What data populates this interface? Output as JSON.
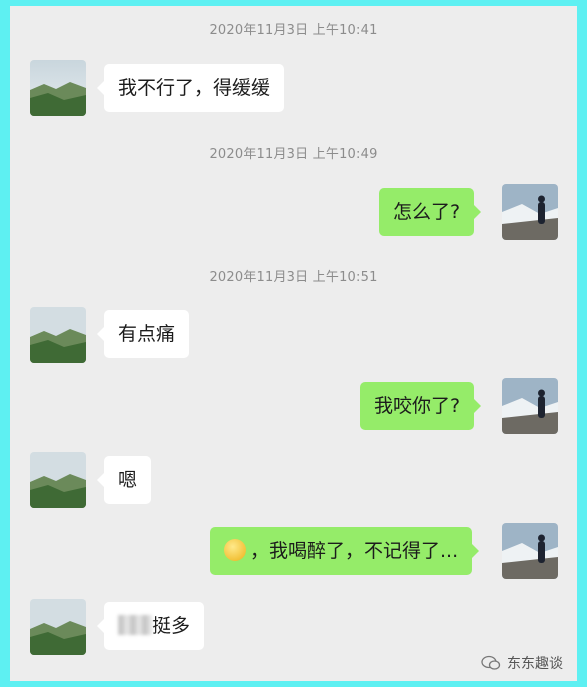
{
  "timestamps": [
    "2020年11月3日 上午10:41",
    "2020年11月3日 上午10:49",
    "2020年11月3日 上午10:51"
  ],
  "messages": [
    {
      "side": "left",
      "text": "我不行了，得缓缓"
    },
    {
      "side": "right",
      "text": "怎么了?"
    },
    {
      "side": "left",
      "text": "有点痛"
    },
    {
      "side": "right",
      "text": "我咬你了?"
    },
    {
      "side": "left",
      "text": "嗯"
    },
    {
      "side": "right",
      "text": "，我喝醉了，不记得了...",
      "emoji": "smiling-face-icon"
    },
    {
      "side": "left",
      "text": "挺多",
      "redacted_prefix": true
    }
  ],
  "watermark": {
    "text": "东东趣谈"
  },
  "colors": {
    "outer_border": "#5ef0f2",
    "chat_bg": "#ededed",
    "outgoing_bubble": "#95ec69",
    "incoming_bubble": "#ffffff"
  }
}
